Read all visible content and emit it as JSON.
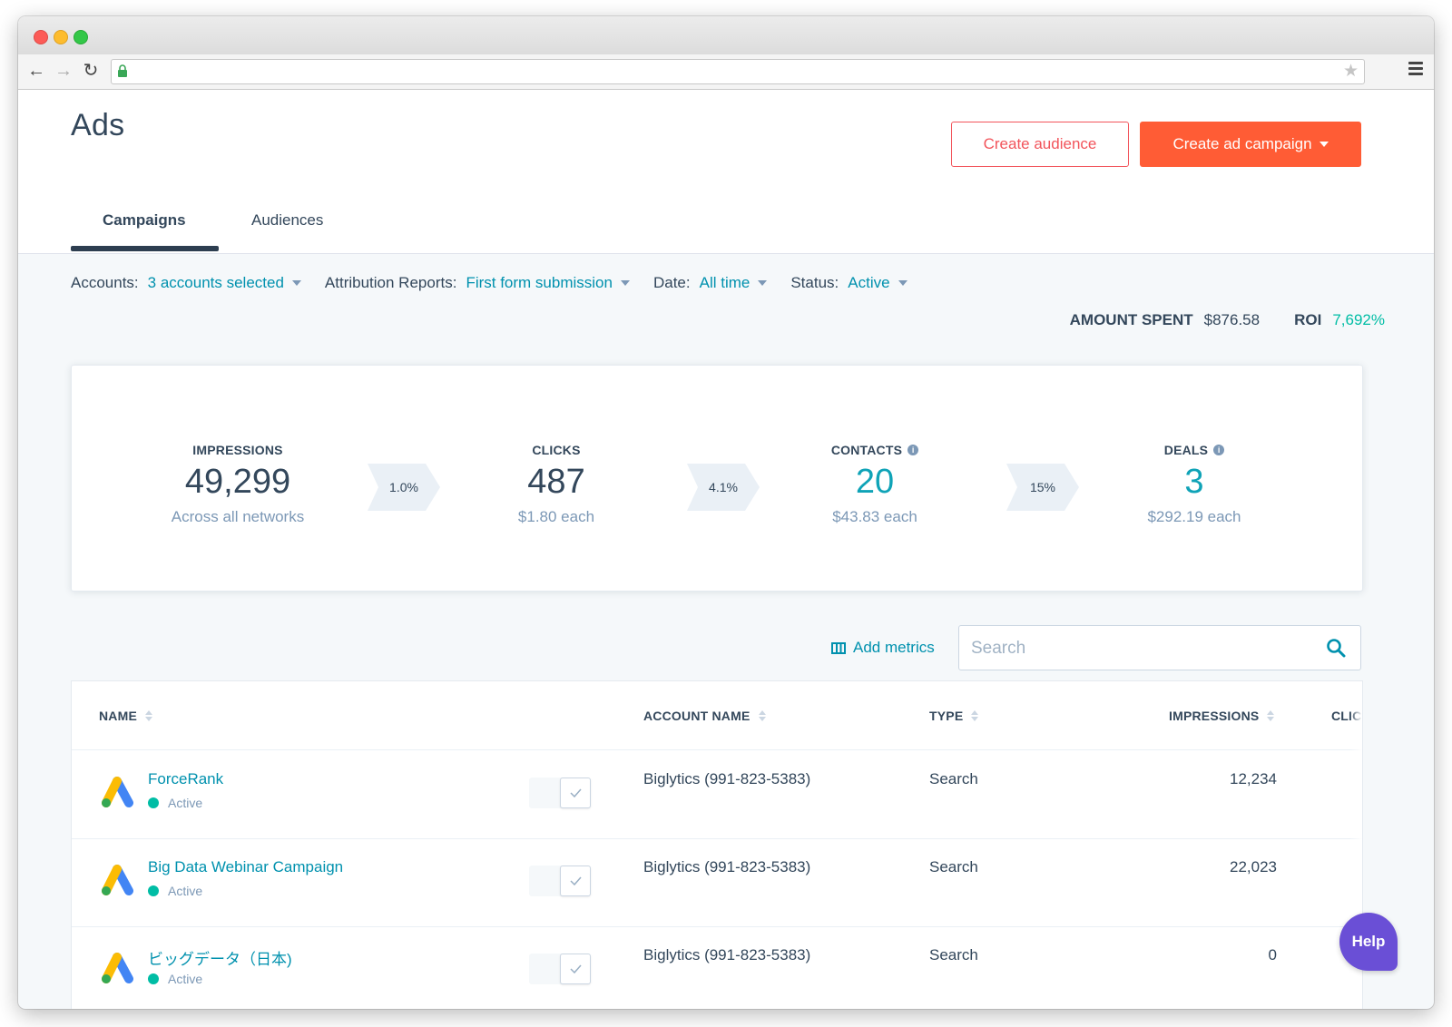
{
  "browser": {
    "url": ""
  },
  "header": {
    "title": "Ads",
    "create_audience_label": "Create audience",
    "create_campaign_label": "Create ad campaign"
  },
  "tabs": [
    {
      "label": "Campaigns",
      "active": true
    },
    {
      "label": "Audiences",
      "active": false
    }
  ],
  "filters": [
    {
      "label": "Accounts:",
      "value": "3 accounts selected"
    },
    {
      "label": "Attribution Reports:",
      "value": "First form submission"
    },
    {
      "label": "Date:",
      "value": "All time"
    },
    {
      "label": "Status:",
      "value": "Active"
    }
  ],
  "summary": {
    "amount_spent_label": "AMOUNT SPENT",
    "amount_spent_value": "$876.58",
    "roi_label": "ROI",
    "roi_value": "7,692%"
  },
  "funnel": {
    "metrics": [
      {
        "label": "IMPRESSIONS",
        "value": "49,299",
        "sub": "Across all networks",
        "info": false
      },
      {
        "label": "CLICKS",
        "value": "487",
        "sub": "$1.80 each",
        "info": false
      },
      {
        "label": "CONTACTS",
        "value": "20",
        "sub": "$43.83 each",
        "info": true
      },
      {
        "label": "DEALS",
        "value": "3",
        "sub": "$292.19 each",
        "info": true
      }
    ],
    "rates": [
      "1.0%",
      "4.1%",
      "15%"
    ]
  },
  "toolbar": {
    "add_metrics_label": "Add metrics",
    "search_placeholder": "Search"
  },
  "table": {
    "columns": [
      "NAME",
      "ACCOUNT NAME",
      "TYPE",
      "IMPRESSIONS",
      "CLIC"
    ],
    "rows": [
      {
        "name": "ForceRank",
        "status": "Active",
        "account": "Biglytics (991-823-5383)",
        "type": "Search",
        "impressions": "12,234"
      },
      {
        "name": "Big Data Webinar Campaign",
        "status": "Active",
        "account": "Biglytics (991-823-5383)",
        "type": "Search",
        "impressions": "22,023"
      },
      {
        "name": "ビッグデータ（日本)",
        "status": "Active",
        "account": "Biglytics (991-823-5383)",
        "type": "Search",
        "impressions": "0"
      }
    ]
  },
  "help": {
    "label": "Help"
  },
  "colors": {
    "accent_orange": "#ff5c35",
    "link_teal": "#0091ae",
    "active_green": "#00bda5",
    "help_purple": "#6a4fd6"
  }
}
